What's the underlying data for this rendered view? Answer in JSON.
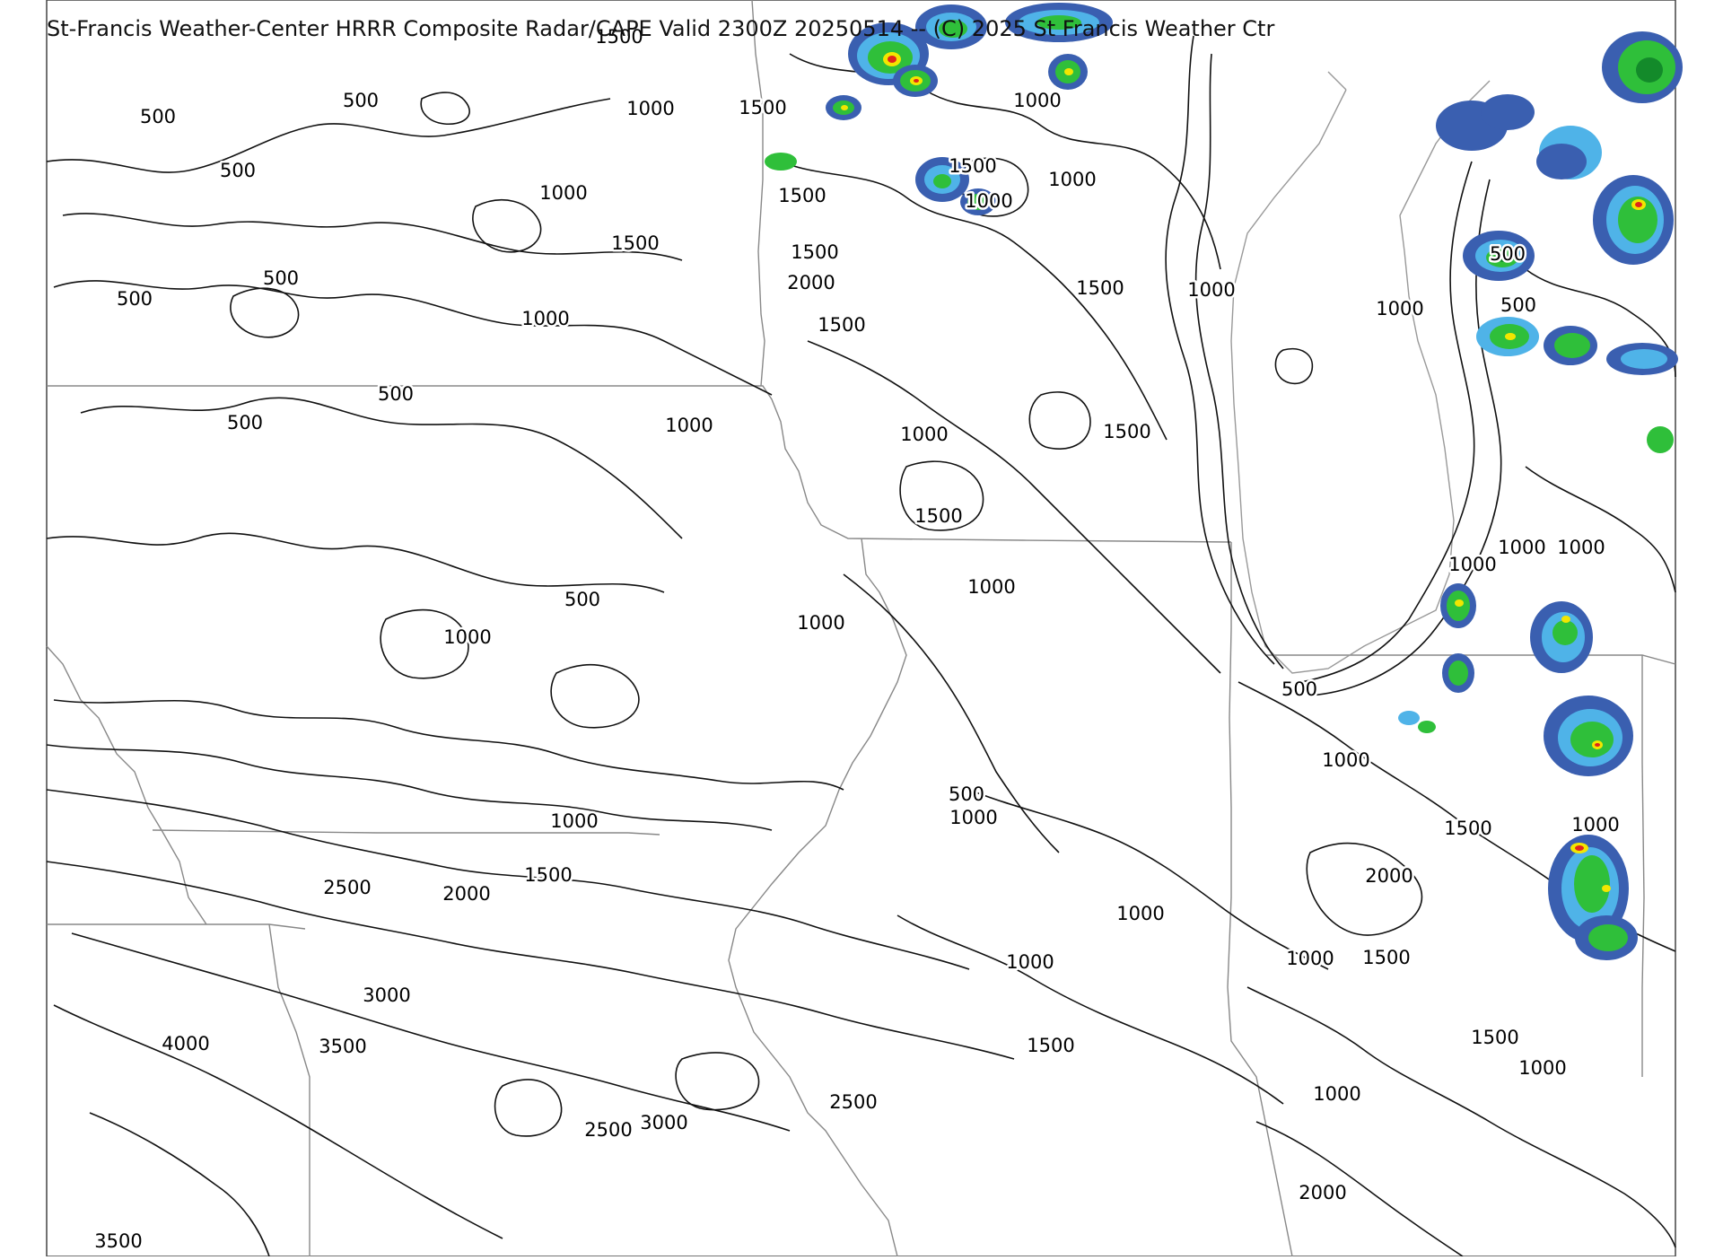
{
  "title": "St-Francis Weather-Center HRRR Composite Radar/CAPE Valid 2300Z 20250514 -- (C) 2025 St Francis Weather Ctr",
  "colors": {
    "radar_light": "#4fb3e8",
    "radar_blue": "#3a5fb0",
    "radar_green": "#2fbf3a",
    "radar_darkgreen": "#138a2a",
    "radar_yellow": "#f2e600",
    "radar_red": "#e0261b",
    "contour": "#111111",
    "border": "#888888"
  },
  "cape_labels": [
    {
      "text": "1500"
    },
    {
      "text": "500"
    },
    {
      "text": "500"
    },
    {
      "text": "1000"
    },
    {
      "text": "1500"
    },
    {
      "text": "500"
    },
    {
      "text": "1000"
    },
    {
      "text": "1500"
    },
    {
      "text": "1500"
    },
    {
      "text": "1000"
    },
    {
      "text": "1500"
    },
    {
      "text": "1000"
    },
    {
      "text": "1000"
    },
    {
      "text": "500"
    },
    {
      "text": "500"
    },
    {
      "text": "1500"
    },
    {
      "text": "2000"
    },
    {
      "text": "1500"
    },
    {
      "text": "1000"
    },
    {
      "text": "1500"
    },
    {
      "text": "500"
    },
    {
      "text": "1000"
    },
    {
      "text": "1000"
    },
    {
      "text": "500"
    },
    {
      "text": "500"
    },
    {
      "text": "500"
    },
    {
      "text": "1000"
    },
    {
      "text": "1000"
    },
    {
      "text": "1500"
    },
    {
      "text": "1500"
    },
    {
      "text": "1000"
    },
    {
      "text": "1000"
    },
    {
      "text": "1000"
    },
    {
      "text": "500"
    },
    {
      "text": "1000"
    },
    {
      "text": "500"
    },
    {
      "text": "1000"
    },
    {
      "text": "1000"
    },
    {
      "text": "500"
    },
    {
      "text": "1000"
    },
    {
      "text": "1000"
    },
    {
      "text": "1000"
    },
    {
      "text": "1500"
    },
    {
      "text": "1000"
    },
    {
      "text": "2500"
    },
    {
      "text": "2000"
    },
    {
      "text": "1500"
    },
    {
      "text": "2000"
    },
    {
      "text": "1000"
    },
    {
      "text": "3000"
    },
    {
      "text": "1000"
    },
    {
      "text": "1000"
    },
    {
      "text": "1500"
    },
    {
      "text": "4000"
    },
    {
      "text": "3500"
    },
    {
      "text": "1500"
    },
    {
      "text": "1500"
    },
    {
      "text": "1000"
    },
    {
      "text": "2500"
    },
    {
      "text": "3000"
    },
    {
      "text": "2500"
    },
    {
      "text": "1000"
    },
    {
      "text": "2000"
    },
    {
      "text": "3500"
    }
  ]
}
